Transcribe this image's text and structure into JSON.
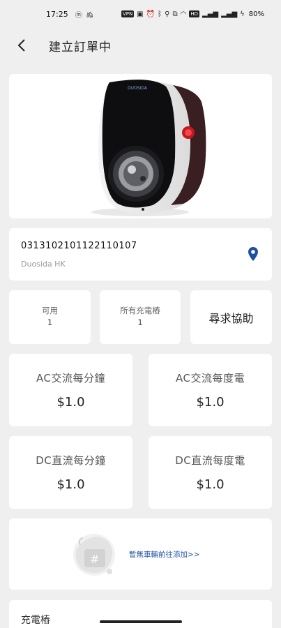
{
  "status_bar": {
    "time": "17:25",
    "left_icon": "ⓜ",
    "chips": [
      "VPN",
      "HD"
    ],
    "battery": "80%"
  },
  "header": {
    "title": "建立訂單中",
    "back_icon": "chevron-left-icon"
  },
  "station": {
    "id": "0313102101122110107",
    "operator": "Duosida HK",
    "product_brand": "DUOSIDA",
    "location_icon": "map-pin-icon",
    "accent": "#1f4fa0"
  },
  "stats": {
    "available_label": "可用",
    "available_value": "1",
    "all_label": "所有充電樁",
    "all_value": "1",
    "help_label": "尋求協助"
  },
  "pricing": [
    {
      "label": "AC交流每分鐘",
      "value": "$1.0"
    },
    {
      "label": "AC交流每度電",
      "value": "$1.0"
    },
    {
      "label": "DC直流每分鐘",
      "value": "$1.0"
    },
    {
      "label": "DC直流每度電",
      "value": "$1.0"
    }
  ],
  "vehicle": {
    "empty_text": "暫無車輛前往添加>>",
    "illustration_icon": "car-plate-illustration-icon",
    "link_color": "#2455a5"
  },
  "bottom_section": {
    "label": "充電樁"
  }
}
